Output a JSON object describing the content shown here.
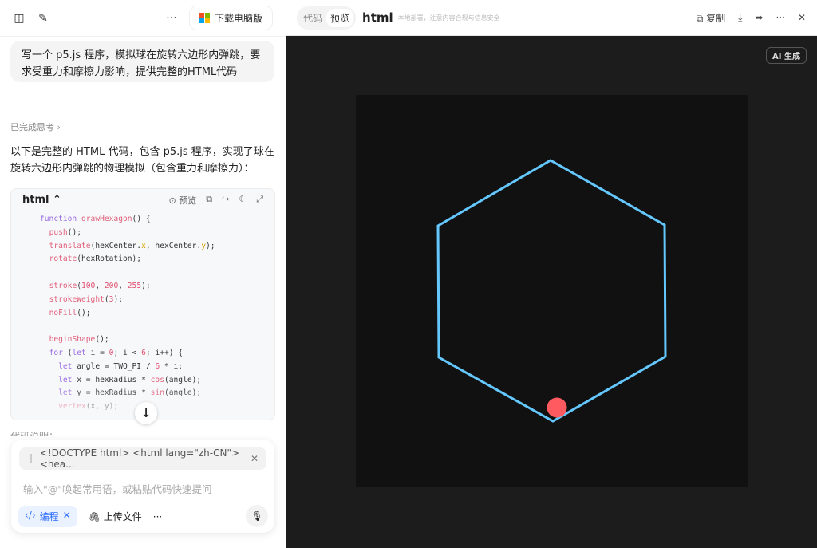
{
  "left": {
    "download_label": "下载电脑版",
    "user_message": "写一个 p5.js 程序，模拟球在旋转六边形内弹跳，要求受重力和摩擦力影响，提供完整的HTML代码",
    "thinking_label": "已完成思考 ›",
    "answer_text": "以下是完整的 HTML 代码，包含 p5.js 程序，实现了球在旋转六边形内弹跳的物理模拟（包含重力和摩擦力）：",
    "code_lang": "html ⌃",
    "code_preview": "预览",
    "truncated_text": "代码说明：",
    "attachment": "<!DOCTYPE html> <html lang=\"zh-CN\"> <hea...",
    "input_placeholder": "输入\"@\"唤起常用语，或粘贴代码快速提问",
    "chip_label": "编程",
    "upload_label": "上传文件"
  },
  "right": {
    "tab_code": "代码",
    "tab_preview": "预览",
    "title": "html",
    "subtitle": "本地部署，注意内容合规与信息安全",
    "copy_label": "复制",
    "ai_badge": "AI 生成",
    "colors": {
      "hexagon": "#64c8ff",
      "ball": "#ff5a5f",
      "background": "#111111"
    }
  }
}
